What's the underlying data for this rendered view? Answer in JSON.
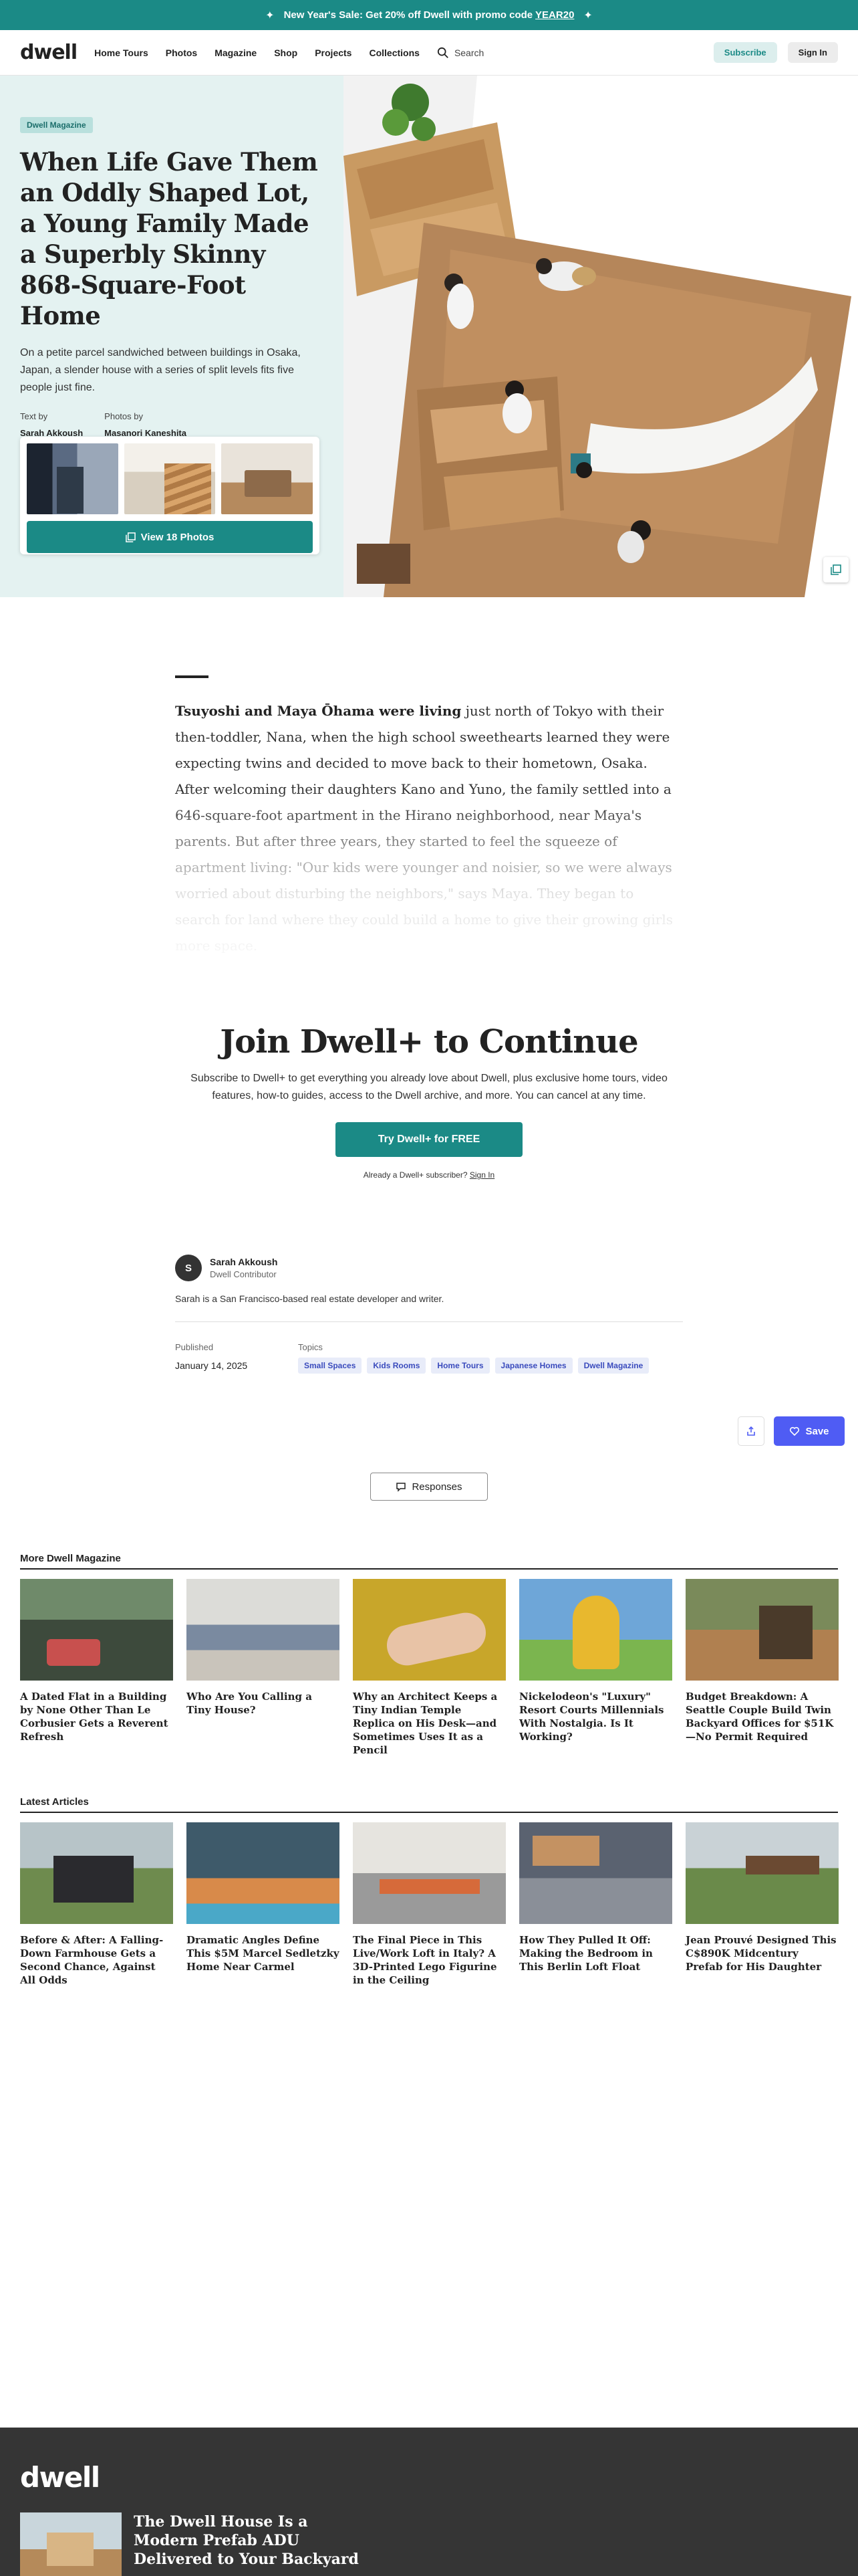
{
  "promo_banner": {
    "text": "New Year's Sale: Get 20% off Dwell with promo code",
    "code": "YEAR20"
  },
  "header": {
    "logo": "dwell",
    "nav": [
      "Home Tours",
      "Photos",
      "Magazine",
      "Shop",
      "Projects",
      "Collections"
    ],
    "search_label": "Search",
    "subscribe_label": "Subscribe",
    "sign_in_label": "Sign In"
  },
  "hero": {
    "tag": "Dwell Magazine",
    "title": "When Life Gave Them an Oddly Shaped Lot, a Young Family Made a Superbly Skinny 868-Square-Foot Home",
    "dek": "On a petite parcel sandwiched between buildings in Osaka, Japan, a slender house with a series of split levels fits five people just fine.",
    "text_by_label": "Text by",
    "text_by": "Sarah Akkoush",
    "photos_by_label": "Photos by",
    "photos_by": "Masanori Kaneshita",
    "view_photos_label": "View 18 Photos"
  },
  "article": {
    "lead_bold": "Tsuyoshi and Maya Ōhama were living",
    "body": " just north of Tokyo with their then-toddler, Nana, when the high school sweethearts learned they were expecting twins and decided to move back to their hometown, Osaka. After welcoming their daughters Kano and Yuno, the family settled into a 646-square-foot apartment in the Hirano neighborhood, near Maya's parents. But after three years, they started to feel the squeeze of apartment living: \"Our kids were younger and noisier, so we were always worried about disturbing the neighbors,\" says Maya. They began to search for land where they could build a home to give their growing girls more space."
  },
  "paywall": {
    "title": "Join Dwell+ to Continue",
    "text": "Subscribe to Dwell+ to get everything you already love about Dwell, plus exclusive home tours, video features, how-to guides, access to the Dwell archive, and more. You can cancel at any time.",
    "cta": "Try Dwell+ for FREE",
    "already_text": "Already a Dwell+ subscriber?",
    "sign_in_link": "Sign In"
  },
  "author": {
    "initial": "S",
    "name": "Sarah Akkoush",
    "role": "Dwell Contributor",
    "bio": "Sarah is a San Francisco-based real estate developer and writer.",
    "published_label": "Published",
    "published_date": "January 14, 2025",
    "topics_label": "Topics",
    "topics": [
      "Small Spaces",
      "Kids Rooms",
      "Home Tours",
      "Japanese Homes",
      "Dwell Magazine"
    ]
  },
  "actions": {
    "save_label": "Save",
    "responses_label": "Responses"
  },
  "more_magazine": {
    "title": "More Dwell Magazine",
    "items": [
      "A Dated Flat in a Building by None Other Than Le Corbusier Gets a Reverent Refresh",
      "Who Are You Calling a Tiny House?",
      "Why an Architect Keeps a Tiny Indian Temple Replica on His Desk—and Sometimes Uses It as a Pencil",
      "Nickelodeon's \"Luxury\" Resort Courts Millennials With Nostalgia. Is It Working?",
      "Budget Breakdown: A Seattle Couple Build Twin Backyard Offices for $51K—No Permit Required"
    ]
  },
  "latest": {
    "title": "Latest Articles",
    "items": [
      "Before & After: A Falling-Down Farmhouse Gets a Second Chance, Against All Odds",
      "Dramatic Angles Define This $5M Marcel Sedletzky Home Near Carmel",
      "The Final Piece in This Live/Work Loft in Italy? A 3D-Printed Lego Figurine in the Ceiling",
      "How They Pulled It Off: Making the Bedroom in This Berlin Loft Float",
      "Jean Prouvé Designed This C$890K Midcentury Prefab for His Daughter"
    ]
  },
  "footer": {
    "logo": "dwell",
    "promo_title": "The Dwell House Is a Modern Prefab ADU Delivered to Your Backyard"
  }
}
